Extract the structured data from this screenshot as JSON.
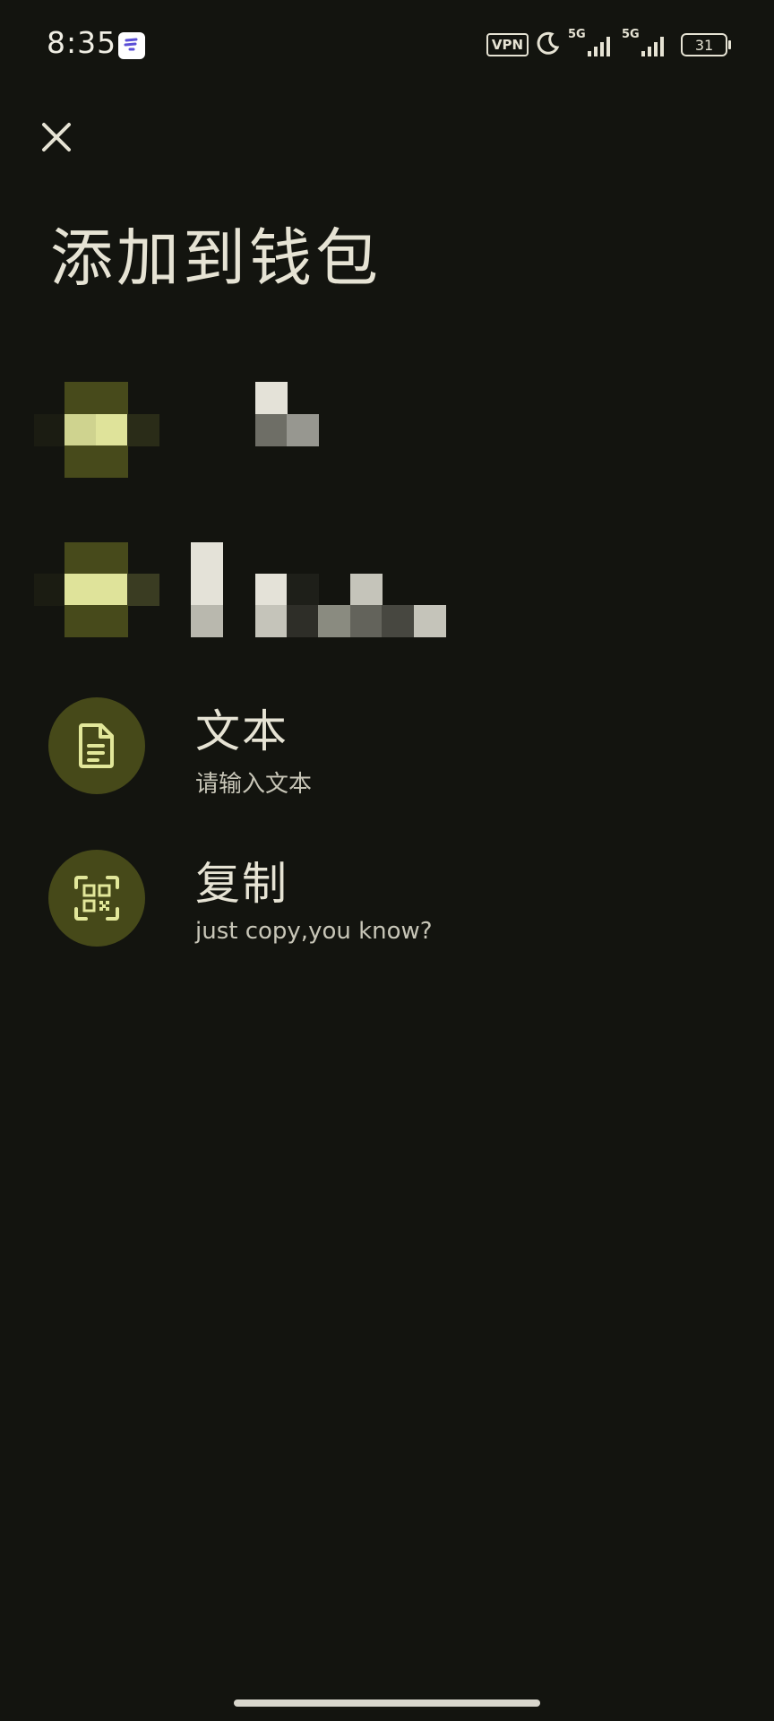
{
  "status_bar": {
    "time": "8:35",
    "vpn": "VPN",
    "sim1": "5G",
    "sim2": "5G",
    "battery": "31",
    "icons": [
      "app-notification-icon",
      "moon-icon",
      "signal-icon",
      "battery-icon"
    ]
  },
  "header": {
    "close_icon": "close-icon",
    "title": "添加到钱包"
  },
  "options": [
    {
      "icon": "document-icon",
      "title": "文本",
      "subtitle": "请输入文本"
    },
    {
      "icon": "qr-scan-icon",
      "title": "复制",
      "subtitle": "just copy,you know?"
    }
  ],
  "colors": {
    "background": "#13140f",
    "accent_circle": "#464919",
    "accent_icon": "#e2e79a",
    "text": "#e6e3d4"
  }
}
